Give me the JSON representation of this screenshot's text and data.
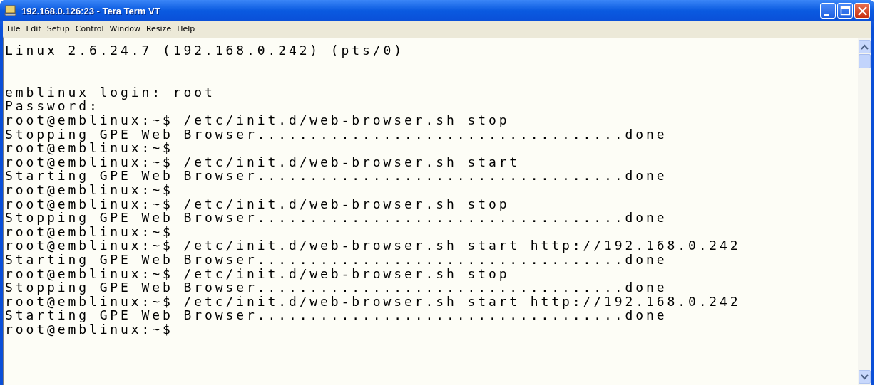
{
  "window": {
    "title": "192.168.0.126:23 - Tera Term VT"
  },
  "menu": [
    "File",
    "Edit",
    "Setup",
    "Control",
    "Window",
    "Resize",
    "Help"
  ],
  "terminal": {
    "banner": "Linux 2.6.24.7 (192.168.0.242) (pts/0)",
    "lines": [
      "emblinux login: root",
      "Password:",
      "root@emblinux:~$ /etc/init.d/web-browser.sh stop",
      "Stopping GPE Web Browser...................................done",
      "root@emblinux:~$",
      "root@emblinux:~$ /etc/init.d/web-browser.sh start",
      "Starting GPE Web Browser...................................done",
      "root@emblinux:~$",
      "root@emblinux:~$ /etc/init.d/web-browser.sh stop",
      "Stopping GPE Web Browser...................................done",
      "root@emblinux:~$",
      "root@emblinux:~$ /etc/init.d/web-browser.sh start http://192.168.0.242",
      "Starting GPE Web Browser...................................done",
      "root@emblinux:~$ /etc/init.d/web-browser.sh stop",
      "Stopping GPE Web Browser...................................done",
      "root@emblinux:~$ /etc/init.d/web-browser.sh start http://192.168.0.242",
      "Starting GPE Web Browser...................................done",
      "root@emblinux:~$"
    ]
  }
}
